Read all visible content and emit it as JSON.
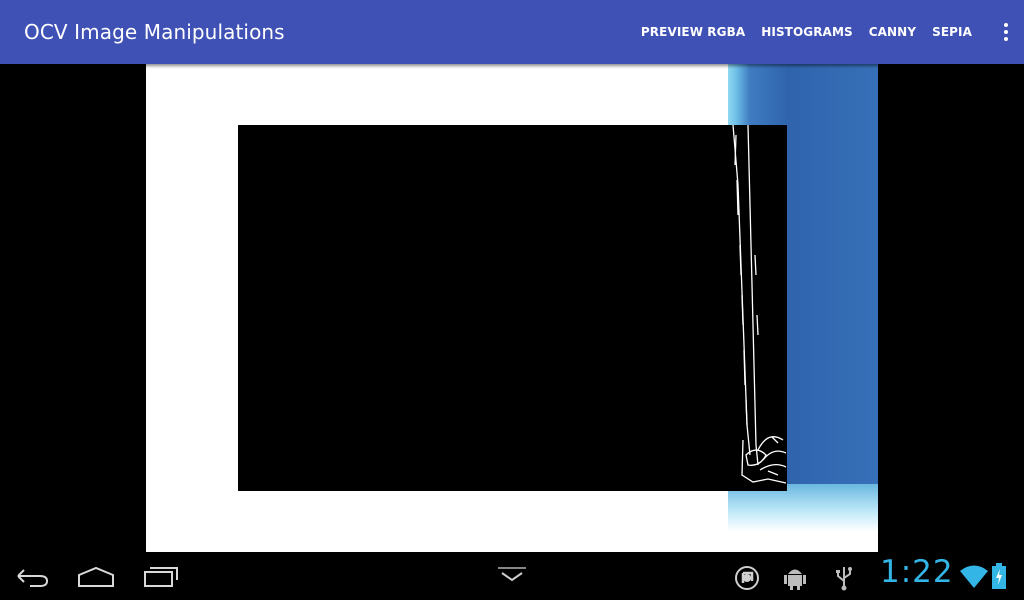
{
  "app": {
    "title": "OCV Image Manipulations"
  },
  "menu": {
    "items": [
      {
        "label": "PREVIEW RGBA"
      },
      {
        "label": "HISTOGRAMS"
      },
      {
        "label": "CANNY"
      },
      {
        "label": "SEPIA"
      }
    ],
    "overflow_icon": "more-vert-icon"
  },
  "camera": {
    "active_filter": "canny"
  },
  "system_bar": {
    "clock": "1:22",
    "nav_icons": [
      "back-icon",
      "home-icon",
      "recent-apps-icon",
      "hide-keyboard-icon"
    ],
    "status_icons": [
      "sync-icon",
      "android-debug-icon",
      "usb-icon",
      "wifi-icon",
      "battery-icon"
    ],
    "accent_color": "#33b5e5"
  },
  "colors": {
    "action_bar": "#3f51b5"
  }
}
